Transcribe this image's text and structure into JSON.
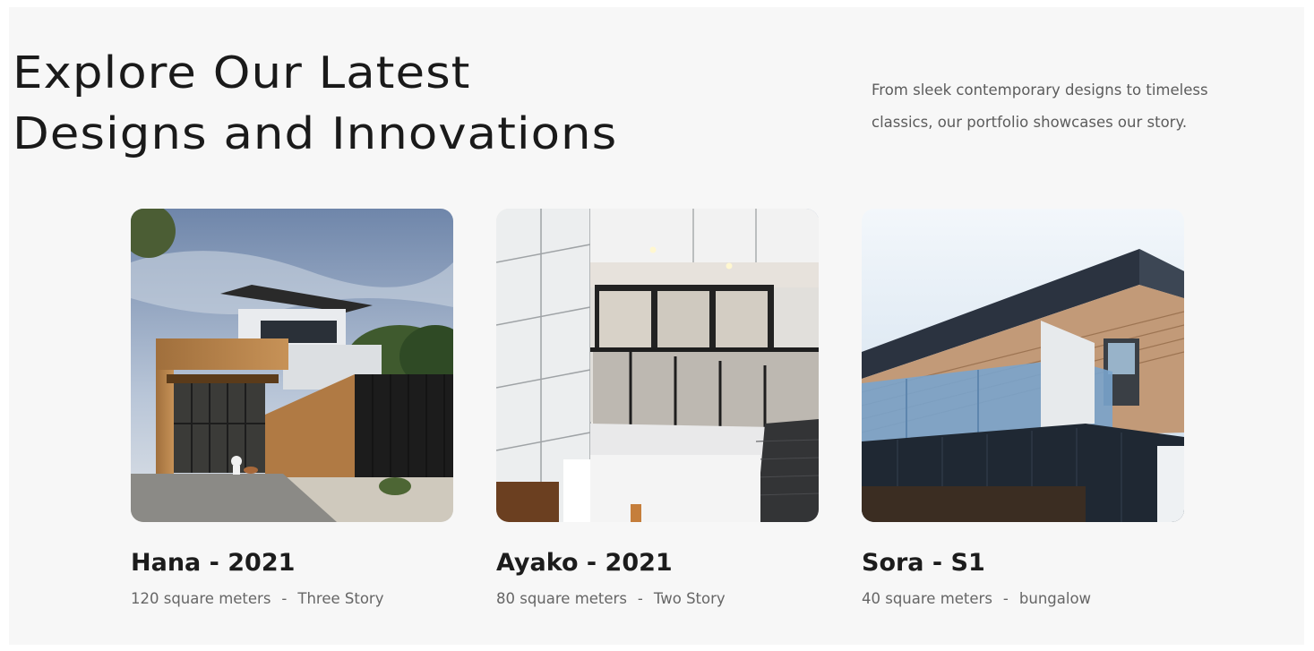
{
  "heading": {
    "line1": "Explore Our Latest",
    "line2": "Designs and Innovations"
  },
  "intro": {
    "line1": "From sleek contemporary designs to timeless",
    "line2": "classics, our portfolio showcases our story."
  },
  "projects": [
    {
      "title": "Hana - 2021",
      "area": "120 square meters",
      "separator": "-",
      "type": "Three Story",
      "image": "modern-three-story-house-photo"
    },
    {
      "title": "Ayako - 2021",
      "area": "80 square meters",
      "separator": "-",
      "type": "Two Story",
      "image": "two-story-facade-balcony-photo"
    },
    {
      "title": "Sora - S1",
      "area": "40 square meters",
      "separator": "-",
      "type": "bungalow",
      "image": "bungalow-roof-balcony-photo"
    }
  ],
  "colors": {
    "section_background": "#f7f7f7",
    "heading": "#1a1a1a",
    "body_text": "#5c5c5c",
    "meta_text": "#666666"
  }
}
